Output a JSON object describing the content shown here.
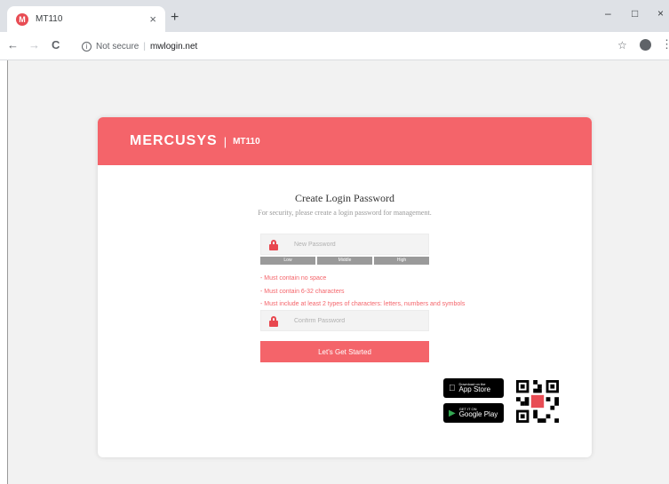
{
  "browser": {
    "tab_title": "MT110",
    "favicon_letter": "M",
    "new_tab_label": "+",
    "close_tab_label": "×",
    "minimize_label": "–",
    "maximize_label": "□",
    "close_window_label": "×",
    "back_label": "←",
    "forward_label": "→",
    "reload_label": "C",
    "info_label": "i",
    "security_label": "Not secure",
    "separator": "|",
    "url": "mwlogin.net",
    "star_label": "☆",
    "more_label": "⋮"
  },
  "header": {
    "brand": "MERCUSYS",
    "separator": "|",
    "model": "MT110",
    "color": "#f4646a"
  },
  "form": {
    "title": "Create Login Password",
    "subtitle": "For security, please create a login password for management.",
    "new_password_placeholder": "New Password",
    "confirm_password_placeholder": "Confirm Password",
    "strength": [
      "Low",
      "Middle",
      "High"
    ],
    "rules": [
      "- Must contain no space",
      "- Must contain 6-32 characters",
      "- Must include at least 2 types of characters: letters, numbers and symbols"
    ],
    "submit_label": "Let's Get Started"
  },
  "apps": {
    "app_store_small": "Download on the",
    "app_store_big": "App Store",
    "google_play_small": "GET IT ON",
    "google_play_big": "Google Play"
  },
  "icons": [
    "favicon",
    "info-icon",
    "star-icon",
    "account-icon",
    "lock-icon",
    "apple-icon",
    "play-icon",
    "qr-code"
  ]
}
